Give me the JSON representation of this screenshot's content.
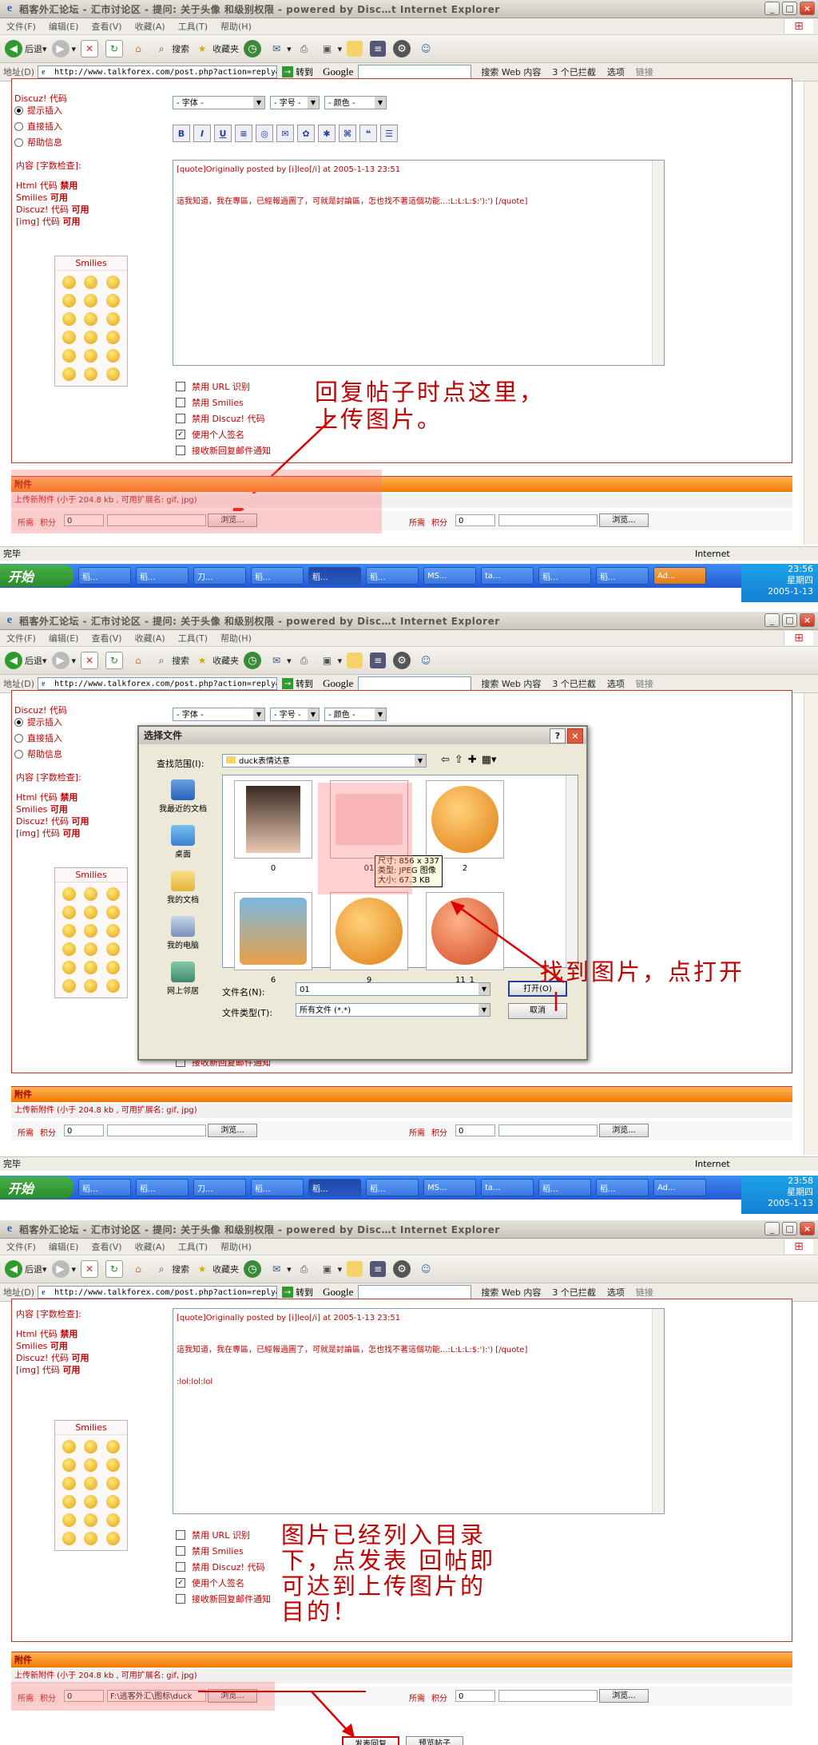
{
  "browser": {
    "title": "稻客外汇论坛 - 汇市讨论区 - 提问: 关于头像 和级别权限 - powered by Disc…t Internet Explorer",
    "menu": [
      "文件(F)",
      "编辑(E)",
      "查看(V)",
      "收藏(A)",
      "工具(T)",
      "帮助(H)"
    ],
    "toolbar": {
      "back": "后退",
      "search": "搜索",
      "favorites": "收藏夹"
    },
    "address_label": "地址(D)",
    "url": "http://www.talkforex.com/post.php?action=reply&",
    "go": "转到",
    "google": "Google",
    "search_web": "搜索 Web 内容",
    "blocked": "3 个已拦截",
    "options": "选项",
    "links": "链接"
  },
  "form": {
    "discuz_code_label": "Discuz! 代码",
    "radio_options": [
      "提示插入",
      "直接插入",
      "帮助信息"
    ],
    "font_select": "- 字体 -",
    "size_select": "- 字号 -",
    "color_select": "- 颜色 -",
    "content_label": "内容 [字数检查]:",
    "html_label": "Html 代码",
    "html_value": "禁用",
    "smilies_label": "Smilies",
    "smilies_value": "可用",
    "discuz_label": "Discuz! 代码",
    "discuz_value": "可用",
    "img_label": "[img] 代码",
    "img_value": "可用",
    "smilies_box_title": "Smilies",
    "quote_line1": "[quote]Originally posted by [i]leo[/i] at 2005-1-13 23:51",
    "quote_line2": "這我知道，我在專區，已經報過圖了，可就是討論區，怎也找不著這個功能...:L:L:L:$:'):') [/quote]",
    "lol_line": ":lol:lol:lol",
    "checkboxes": [
      "禁用 URL 识别",
      "禁用 Smilies",
      "禁用 Discuz! 代码",
      "使用个人签名",
      "接收新回复邮件通知"
    ],
    "checked": [
      false,
      false,
      false,
      true,
      false
    ]
  },
  "attach": {
    "header": "附件",
    "upload_info": "上传新附件 (小于 204.8 kb , 可用扩展名: gif, jpg)",
    "required": "所需",
    "credits": "积分",
    "credits_value": "0",
    "browse": "浏览...",
    "path_value": "F:\\逃客外汇\\图标\\duck"
  },
  "annotations": {
    "step1": [
      "回复帖子时点这里，",
      "上传图片。"
    ],
    "step2": "找到图片，点打开",
    "step3": [
      "图片已经列入目录",
      "下，点发表 回帖即",
      "可达到上传图片的",
      "目的！"
    ]
  },
  "status": {
    "done": "完毕",
    "zone": "Internet"
  },
  "taskbar": {
    "start": "开始",
    "items": [
      "稻...",
      "稻...",
      "刀...",
      "稻...",
      "稻...",
      "稻...",
      "MS...",
      "ta...",
      "稻...",
      "稻...",
      "Ad..."
    ],
    "time1": "23:56",
    "time2": "23:58",
    "weekday": "星期四",
    "date": "2005-1-13"
  },
  "dialog": {
    "title": "选择文件",
    "lookin_label": "查找范围(I):",
    "folder": "duck表情达意",
    "places": [
      "我最近的文档",
      "桌面",
      "我的文档",
      "我的电脑",
      "网上邻居"
    ],
    "files": [
      "0",
      "01",
      "2",
      "6",
      "9",
      "11_1"
    ],
    "tooltip": [
      "尺寸: 856 x 337",
      "类型: JPEG 图像",
      "大小: 67.3 KB"
    ],
    "filename_label": "文件名(N):",
    "filename_value": "01",
    "filetype_label": "文件类型(T):",
    "filetype_value": "所有文件 (*.*)",
    "open": "打开(O)",
    "cancel": "取消"
  },
  "submit": {
    "post": "发表回复",
    "preview": "预览帖子"
  },
  "colors": {
    "accent": "#c00000",
    "attach_orange": "#f27700"
  }
}
